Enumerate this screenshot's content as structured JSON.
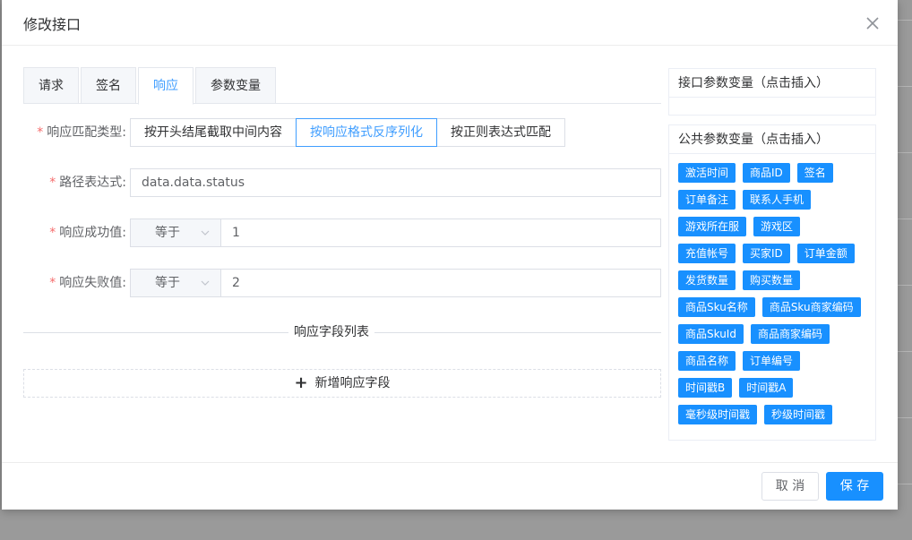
{
  "dialog": {
    "title": "修改接口"
  },
  "tabs": [
    {
      "label": "请求"
    },
    {
      "label": "签名"
    },
    {
      "label": "响应"
    },
    {
      "label": "参数变量"
    }
  ],
  "form": {
    "match_type": {
      "label": "响应匹配类型:",
      "options": [
        "按开头结尾截取中间内容",
        "按响应格式反序列化",
        "按正则表达式匹配"
      ],
      "selected": "按响应格式反序列化"
    },
    "path": {
      "label": "路径表达式:",
      "value": "data.data.status"
    },
    "success": {
      "label": "响应成功值:",
      "operator": "等于",
      "value": "1"
    },
    "failure": {
      "label": "响应失败值:",
      "operator": "等于",
      "value": "2"
    }
  },
  "fields": {
    "divider_label": "响应字段列表",
    "add_label": "新增响应字段"
  },
  "interface_params": {
    "title": "接口参数变量（点击插入）"
  },
  "public_params": {
    "title": "公共参数变量（点击插入）",
    "rows": [
      [
        "激活时间",
        "商品ID",
        "签名"
      ],
      [
        "订单备注",
        "联系人手机"
      ],
      [
        "游戏所在服",
        "游戏区"
      ],
      [
        "充值帐号",
        "买家ID",
        "订单金额"
      ],
      [
        "发货数量",
        "购买数量"
      ],
      [
        "商品Sku名称",
        "商品Sku商家编码"
      ],
      [
        "商品SkuId",
        "商品商家编码"
      ],
      [
        "商品名称",
        "订单编号"
      ],
      [
        "时间戳B",
        "时间戳A"
      ],
      [
        "毫秒级时间戳",
        "秒级时间戳"
      ]
    ],
    "tag_color": "#1890ff"
  },
  "footer": {
    "cancel_label": "取 消",
    "save_label": "保 存"
  },
  "colors": {
    "accent": "#409eff",
    "primary_button": "#1890ff",
    "required_mark": "#f56c6c"
  }
}
